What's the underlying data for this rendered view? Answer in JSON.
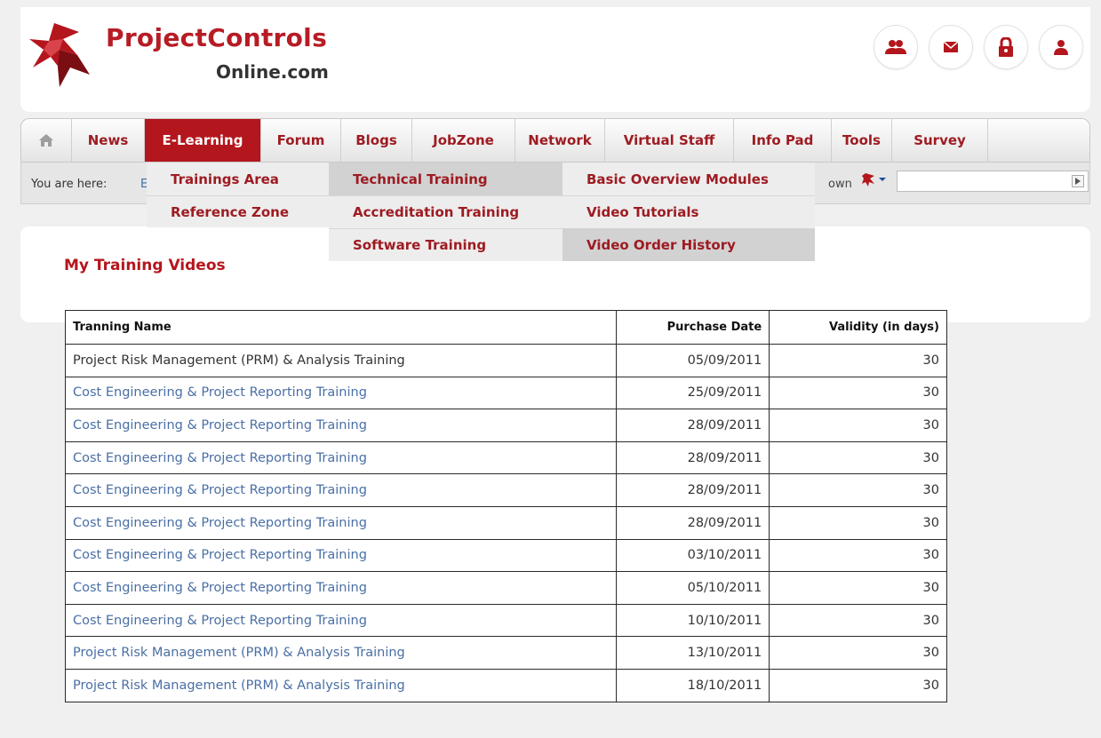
{
  "brand": {
    "line1": "ProjectControls",
    "line2": "Online.com"
  },
  "header_icons": [
    "users-icon",
    "mail-icon",
    "lock-icon",
    "user-icon"
  ],
  "nav": {
    "home_icon": "home-icon",
    "items": [
      "News",
      "E-Learning",
      "Forum",
      "Blogs",
      "JobZone",
      "Network",
      "Virtual Staff",
      "Info Pad",
      "Tools",
      "Survey"
    ],
    "active": "E-Learning"
  },
  "breadcrumb": {
    "label": "You are here:",
    "link": "E",
    "trailing": "own"
  },
  "menus": {
    "col1": [
      "Trainings Area",
      "Reference Zone"
    ],
    "col2": [
      "Technical Training",
      "Accreditation Training",
      "Software Training"
    ],
    "col3": [
      "Basic Overview Modules",
      "Video Tutorials",
      "Video Order History"
    ]
  },
  "page": {
    "title": "My Training Videos"
  },
  "table": {
    "headers": [
      "Tranning Name",
      "Purchase Date",
      "Validity (in days)"
    ],
    "rows": [
      [
        "Project Risk Management (PRM) & Analysis Training",
        "05/09/2011",
        "30"
      ],
      [
        "Cost Engineering & Project Reporting Training",
        "25/09/2011",
        "30"
      ],
      [
        "Cost Engineering & Project Reporting Training",
        "28/09/2011",
        "30"
      ],
      [
        "Cost Engineering & Project Reporting Training",
        "28/09/2011",
        "30"
      ],
      [
        "Cost Engineering & Project Reporting Training",
        "28/09/2011",
        "30"
      ],
      [
        "Cost Engineering & Project Reporting Training",
        "28/09/2011",
        "30"
      ],
      [
        "Cost Engineering & Project Reporting Training",
        "03/10/2011",
        "30"
      ],
      [
        "Cost Engineering & Project Reporting Training",
        "05/10/2011",
        "30"
      ],
      [
        "Cost Engineering & Project Reporting Training",
        "10/10/2011",
        "30"
      ],
      [
        "Project Risk Management (PRM) & Analysis Training",
        "13/10/2011",
        "30"
      ],
      [
        "Project Risk Management (PRM) & Analysis Training",
        "18/10/2011",
        "30"
      ]
    ]
  },
  "colors": {
    "brand_red": "#b4161d",
    "link_blue": "#4a6fa5"
  }
}
